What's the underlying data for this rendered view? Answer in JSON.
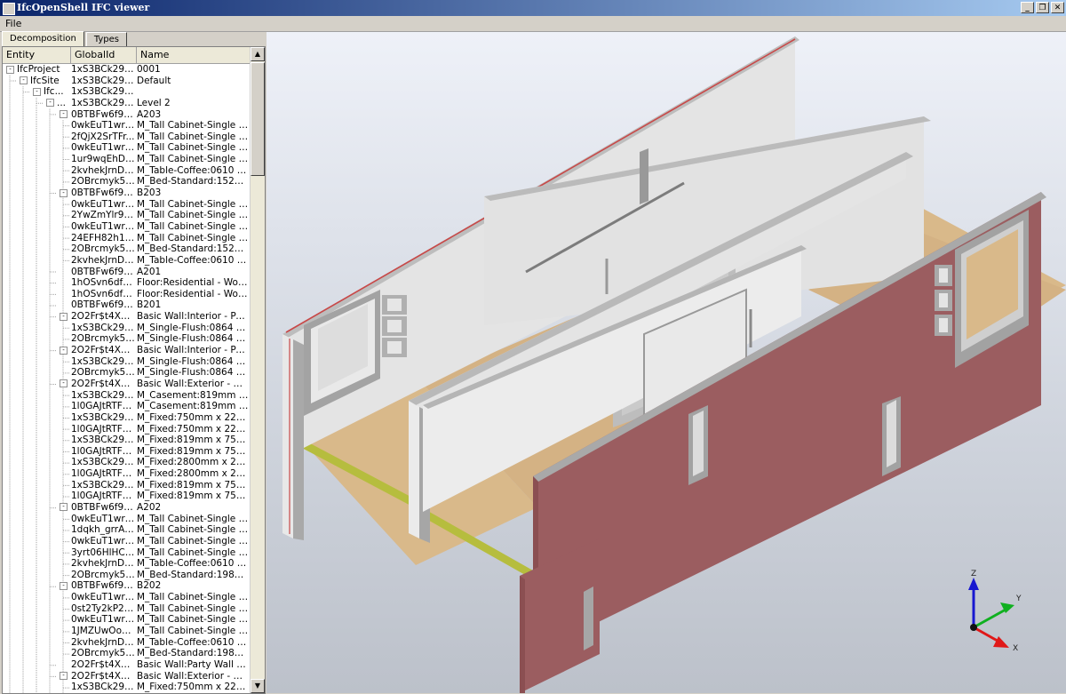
{
  "window": {
    "title": "IfcOpenShell IFC viewer",
    "buttons": [
      "_",
      "❐",
      "✕"
    ]
  },
  "menu": {
    "file": "File"
  },
  "tabs": [
    {
      "label": "Decomposition",
      "active": true
    },
    {
      "label": "Types",
      "active": false
    }
  ],
  "tree": {
    "columns": [
      "Entity",
      "GlobalId",
      "Name"
    ],
    "rows": [
      {
        "entity": "IfcProject",
        "level": 0,
        "expander": "-",
        "gid": "1xS3BCk291...",
        "name": "0001"
      },
      {
        "entity": "IfcSite",
        "level": 1,
        "expander": "-",
        "gid": "1xS3BCk291...",
        "name": "Default"
      },
      {
        "entity": "Ifc...",
        "level": 2,
        "expander": "-",
        "gid": "1xS3BCk291...",
        "name": ""
      },
      {
        "entity": "...",
        "level": 3,
        "expander": "-",
        "gid": "1xS3BCk291...",
        "name": "Level 2"
      },
      {
        "entity": "",
        "level": 4,
        "expander": "-",
        "gid": "0BTBFw6f90...",
        "name": "A203"
      },
      {
        "entity": "",
        "level": 5,
        "expander": "",
        "gid": "0wkEuT1wr1...",
        "name": "M_Tall Cabinet-Single Doo..."
      },
      {
        "entity": "",
        "level": 5,
        "expander": "",
        "gid": "2fQjX2SrTFr...",
        "name": "M_Tall Cabinet-Single Doo..."
      },
      {
        "entity": "",
        "level": 5,
        "expander": "",
        "gid": "0wkEuT1wr1...",
        "name": "M_Tall Cabinet-Single Doo..."
      },
      {
        "entity": "",
        "level": 5,
        "expander": "",
        "gid": "1ur9wqEhD1...",
        "name": "M_Tall Cabinet-Single Doo..."
      },
      {
        "entity": "",
        "level": 5,
        "expander": "",
        "gid": "2kvhekJrnDj...",
        "name": "M_Table-Coffee:0610 x 0..."
      },
      {
        "entity": "",
        "level": 5,
        "expander": "",
        "gid": "2OBrcmyk58...",
        "name": "M_Bed-Standard:1525 x ..."
      },
      {
        "entity": "",
        "level": 4,
        "expander": "-",
        "gid": "0BTBFw6f90...",
        "name": "B203"
      },
      {
        "entity": "",
        "level": 5,
        "expander": "",
        "gid": "0wkEuT1wr1...",
        "name": "M_Tall Cabinet-Single Doo..."
      },
      {
        "entity": "",
        "level": 5,
        "expander": "",
        "gid": "2YwZmYlr9Ai...",
        "name": "M_Tall Cabinet-Single Doo..."
      },
      {
        "entity": "",
        "level": 5,
        "expander": "",
        "gid": "0wkEuT1wr1...",
        "name": "M_Tall Cabinet-Single Doo..."
      },
      {
        "entity": "",
        "level": 5,
        "expander": "",
        "gid": "24EFH82h1D...",
        "name": "M_Tall Cabinet-Single Doo..."
      },
      {
        "entity": "",
        "level": 5,
        "expander": "",
        "gid": "2OBrcmyk58...",
        "name": "M_Bed-Standard:1525 x ..."
      },
      {
        "entity": "",
        "level": 5,
        "expander": "",
        "gid": "2kvhekJrnDj...",
        "name": "M_Table-Coffee:0610 x 0..."
      },
      {
        "entity": "",
        "level": 4,
        "expander": "",
        "gid": "0BTBFw6f90...",
        "name": "A201"
      },
      {
        "entity": "",
        "level": 4,
        "expander": "",
        "gid": "1hOSvn6df7...",
        "name": "Floor:Residential - Wood ..."
      },
      {
        "entity": "",
        "level": 4,
        "expander": "",
        "gid": "1hOSvn6df7...",
        "name": "Floor:Residential - Wood ..."
      },
      {
        "entity": "",
        "level": 4,
        "expander": "",
        "gid": "0BTBFw6f90...",
        "name": "B201"
      },
      {
        "entity": "",
        "level": 4,
        "expander": "-",
        "gid": "2O2Fr$t4X7...",
        "name": "Basic Wall:Interior - Partiti..."
      },
      {
        "entity": "",
        "level": 5,
        "expander": "",
        "gid": "1xS3BCk291...",
        "name": "M_Single-Flush:0864 x 2..."
      },
      {
        "entity": "",
        "level": 5,
        "expander": "",
        "gid": "2OBrcmyk58...",
        "name": "M_Single-Flush:0864 x 2..."
      },
      {
        "entity": "",
        "level": 4,
        "expander": "-",
        "gid": "2O2Fr$t4X7...",
        "name": "Basic Wall:Interior - Partiti..."
      },
      {
        "entity": "",
        "level": 5,
        "expander": "",
        "gid": "1xS3BCk291...",
        "name": "M_Single-Flush:0864 x 2..."
      },
      {
        "entity": "",
        "level": 5,
        "expander": "",
        "gid": "2OBrcmyk58...",
        "name": "M_Single-Flush:0864 x 2..."
      },
      {
        "entity": "",
        "level": 4,
        "expander": "-",
        "gid": "2O2Fr$t4X7...",
        "name": "Basic Wall:Exterior - Brick..."
      },
      {
        "entity": "",
        "level": 5,
        "expander": "",
        "gid": "1xS3BCk291...",
        "name": "M_Casement:819mm x 7..."
      },
      {
        "entity": "",
        "level": 5,
        "expander": "",
        "gid": "1l0GAJtRTFv...",
        "name": "M_Casement:819mm x 7..."
      },
      {
        "entity": "",
        "level": 5,
        "expander": "",
        "gid": "1xS3BCk291...",
        "name": "M_Fixed:750mm x 2200..."
      },
      {
        "entity": "",
        "level": 5,
        "expander": "",
        "gid": "1l0GAJtRTFv...",
        "name": "M_Fixed:750mm x 2200..."
      },
      {
        "entity": "",
        "level": 5,
        "expander": "",
        "gid": "1xS3BCk291...",
        "name": "M_Fixed:819mm x 759m..."
      },
      {
        "entity": "",
        "level": 5,
        "expander": "",
        "gid": "1l0GAJtRTFv...",
        "name": "M_Fixed:819mm x 759m..."
      },
      {
        "entity": "",
        "level": 5,
        "expander": "",
        "gid": "1xS3BCk291...",
        "name": "M_Fixed:2800mm x 241..."
      },
      {
        "entity": "",
        "level": 5,
        "expander": "",
        "gid": "1l0GAJtRTFv...",
        "name": "M_Fixed:2800mm x 241..."
      },
      {
        "entity": "",
        "level": 5,
        "expander": "",
        "gid": "1xS3BCk291...",
        "name": "M_Fixed:819mm x 759m..."
      },
      {
        "entity": "",
        "level": 5,
        "expander": "",
        "gid": "1l0GAJtRTFv...",
        "name": "M_Fixed:819mm x 759m..."
      },
      {
        "entity": "",
        "level": 4,
        "expander": "-",
        "gid": "0BTBFw6f90...",
        "name": "A202"
      },
      {
        "entity": "",
        "level": 5,
        "expander": "",
        "gid": "0wkEuT1wr1...",
        "name": "M_Tall Cabinet-Single Doo..."
      },
      {
        "entity": "",
        "level": 5,
        "expander": "",
        "gid": "1dqkh_grrAr...",
        "name": "M_Tall Cabinet-Single Doo..."
      },
      {
        "entity": "",
        "level": 5,
        "expander": "",
        "gid": "0wkEuT1wr1...",
        "name": "M_Tall Cabinet-Single Doo..."
      },
      {
        "entity": "",
        "level": 5,
        "expander": "",
        "gid": "3yrt06HlHCH...",
        "name": "M_Tall Cabinet-Single Doo..."
      },
      {
        "entity": "",
        "level": 5,
        "expander": "",
        "gid": "2kvhekJrnDj...",
        "name": "M_Table-Coffee:0610 x 0..."
      },
      {
        "entity": "",
        "level": 5,
        "expander": "",
        "gid": "2OBrcmyk58...",
        "name": "M_Bed-Standard:1981 x ..."
      },
      {
        "entity": "",
        "level": 4,
        "expander": "-",
        "gid": "0BTBFw6f90...",
        "name": "B202"
      },
      {
        "entity": "",
        "level": 5,
        "expander": "",
        "gid": "0wkEuT1wr1...",
        "name": "M_Tall Cabinet-Single Doo..."
      },
      {
        "entity": "",
        "level": 5,
        "expander": "",
        "gid": "0st2Ty2kP2i9...",
        "name": "M_Tall Cabinet-Single Doo..."
      },
      {
        "entity": "",
        "level": 5,
        "expander": "",
        "gid": "0wkEuT1wr1...",
        "name": "M_Tall Cabinet-Single Doo..."
      },
      {
        "entity": "",
        "level": 5,
        "expander": "",
        "gid": "1JMZUwOon...",
        "name": "M_Tall Cabinet-Single Doo..."
      },
      {
        "entity": "",
        "level": 5,
        "expander": "",
        "gid": "2kvhekJrnDj...",
        "name": "M_Table-Coffee:0610 x 0..."
      },
      {
        "entity": "",
        "level": 5,
        "expander": "",
        "gid": "2OBrcmyk58...",
        "name": "M_Bed-Standard:1981 x ..."
      },
      {
        "entity": "",
        "level": 4,
        "expander": "",
        "gid": "2O2Fr$t4X7...",
        "name": "Basic Wall:Party Wall - CM..."
      },
      {
        "entity": "",
        "level": 4,
        "expander": "-",
        "gid": "2O2Fr$t4X7...",
        "name": "Basic Wall:Exterior - Brick..."
      },
      {
        "entity": "",
        "level": 5,
        "expander": "",
        "gid": "1xS3BCk291...",
        "name": "M_Fixed:750mm x 2200..."
      }
    ]
  },
  "viewport": {
    "axes": {
      "z": "Z",
      "y": "Y",
      "x": "X"
    },
    "colors": {
      "wall_light": "#e6e6e6",
      "wall_side": "#a8a8a8",
      "brick": "#9c5d60",
      "floor": "#d8b888",
      "slab_edge": "#b8c040",
      "red_stripe": "#cc4040"
    }
  }
}
